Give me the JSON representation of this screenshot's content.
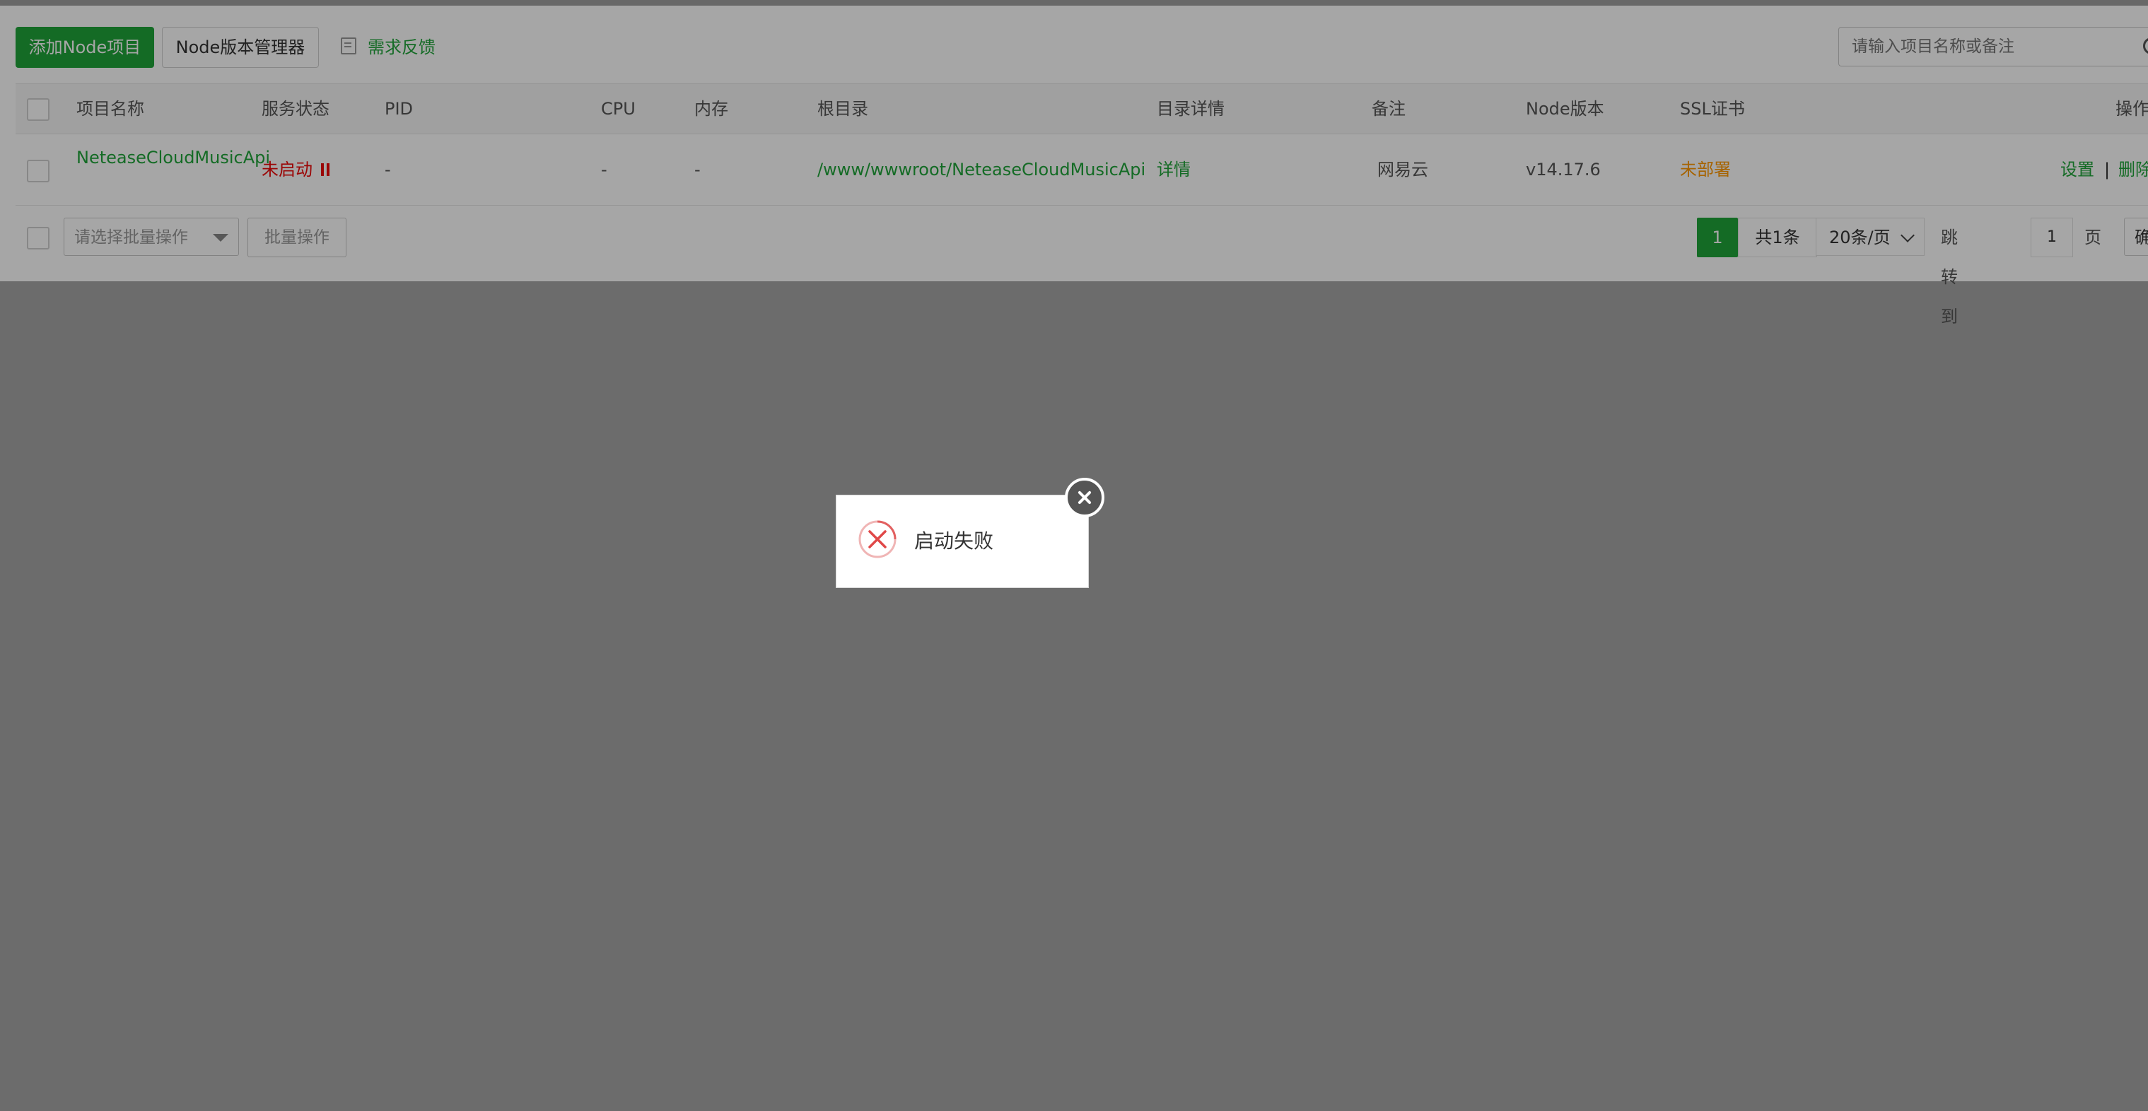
{
  "toolbar": {
    "add_button": "添加Node项目",
    "version_manager_button": "Node版本管理器",
    "feedback_label": "需求反馈",
    "search_placeholder": "请输入项目名称或备注"
  },
  "table": {
    "columns": [
      "项目名称",
      "服务状态",
      "PID",
      "CPU",
      "内存",
      "根目录",
      "目录详情",
      "备注",
      "Node版本",
      "SSL证书",
      "操作"
    ],
    "rows": [
      {
        "name": "NeteaseCloudMusicApi",
        "status": "未启动",
        "pid": "-",
        "cpu": "-",
        "memory": "-",
        "root": "/www/wwwroot/NeteaseCloudMusicApi",
        "detail": "详情",
        "remark": "网易云",
        "node_version": "v14.17.6",
        "ssl": "未部署",
        "action_settings": "设置",
        "action_separator": "|",
        "action_delete": "删除"
      }
    ]
  },
  "footer": {
    "batch_select_placeholder": "请选择批量操作",
    "batch_button": "批量操作",
    "pager": {
      "current_page": "1",
      "total": "共1条",
      "page_size": "20条/页",
      "jump_label": "跳转到",
      "jump_value": "1",
      "page_unit": "页",
      "confirm": "确认"
    }
  },
  "toast": {
    "message": "启动失败",
    "icon": "error-circle-icon",
    "close_icon": "close-icon"
  },
  "colors": {
    "accent": "#20a53a",
    "error": "#ef0808",
    "warning": "#ff9900"
  }
}
